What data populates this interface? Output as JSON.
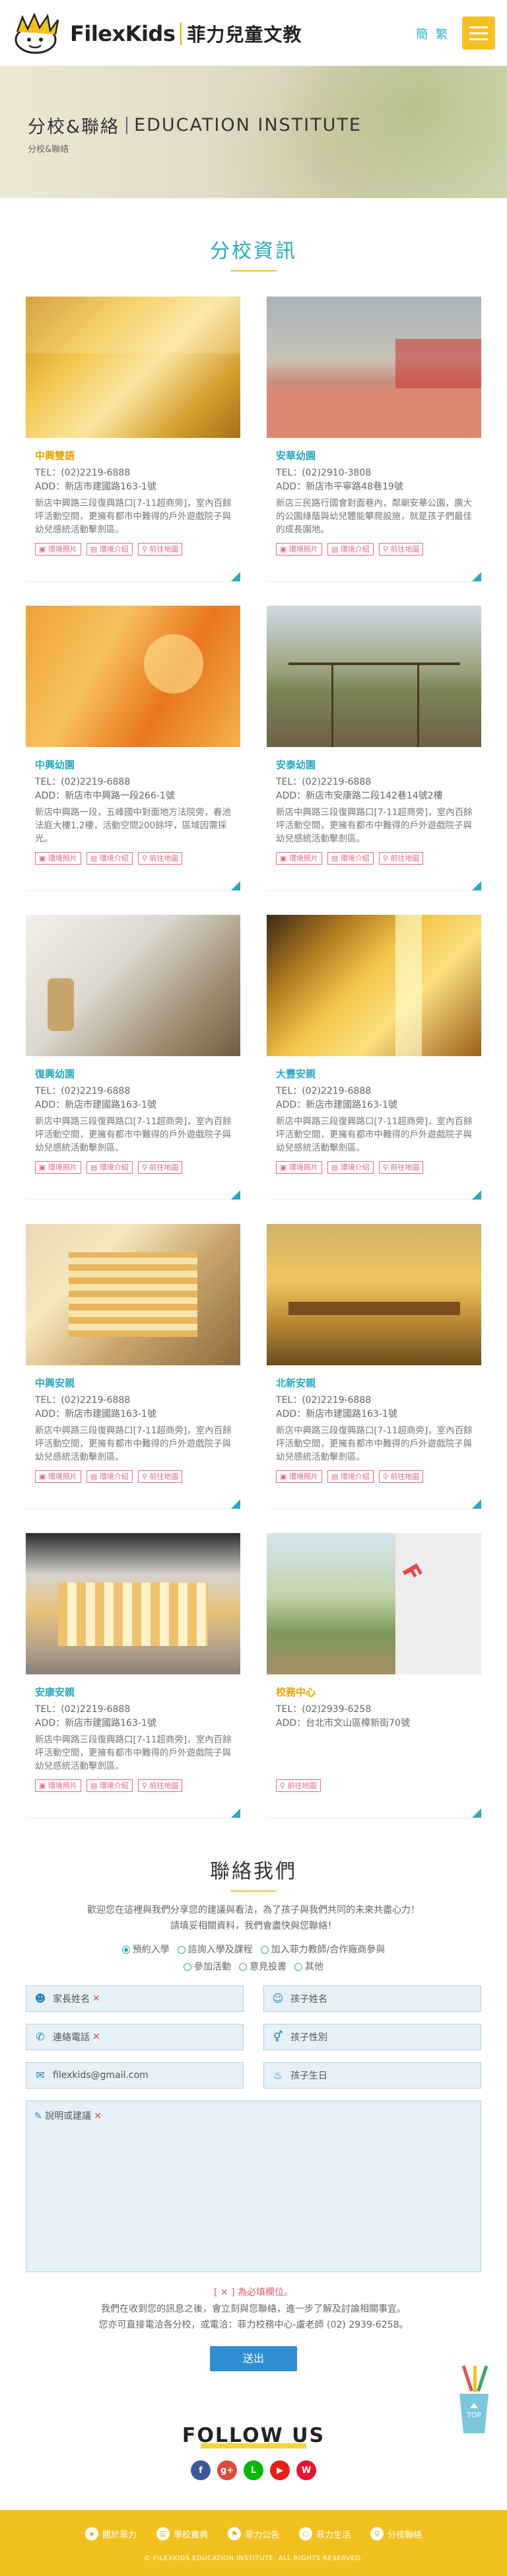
{
  "header": {
    "logo_text": "FilexKids",
    "logo_cn": "菲力兒童文教",
    "lang_simplified": "簡",
    "lang_traditional": "繁",
    "menu_icon": "hamburger-icon"
  },
  "banner": {
    "title_cn": "分校&聯絡",
    "title_en": "EDUCATION INSTITUTE",
    "breadcrumb": "分校&聯絡"
  },
  "schools_title": "分校資訊",
  "button_labels": {
    "photos": "環境照片",
    "intro": "環境介紹",
    "map": "前往地圖"
  },
  "schools": [
    {
      "name": "中興雙語",
      "tel": "TEL：(02)2219-6888",
      "add": "ADD：新店市建國路163-1號",
      "desc": "新店中興路三段復興路口[7-11超商旁]，室內百餘坪活動空間，更擁有都市中難得的戶外遊戲院子與幼兒感統活動擊劍區。",
      "color": "#e8a400"
    },
    {
      "name": "安華幼園",
      "tel": "TEL：(02)2910-3808",
      "add": "ADD：新店市平寧路48巷19號",
      "desc": "新店三民路行國會對面巷內，鄰廟安華公園，廣大的公園綠蔭與幼兒體能攀爬設施，就是孩子們最佳的成長園地。",
      "color": "#2aa9be"
    },
    {
      "name": "中興幼園",
      "tel": "TEL：(02)2219-6888",
      "add": "ADD：新店市中興路一段266-1號",
      "desc": "新店中興路一段，五峰國中對面地方法院旁，春池法庭大樓1,2樓，活動空間200餘坪，區域因需採光。",
      "color": "#2aa9be"
    },
    {
      "name": "安泰幼園",
      "tel": "TEL：(02)2219-6888",
      "add": "ADD：新店市安康路二段142巷14號2樓",
      "desc": "新店中興路三段復興路口[7-11超商旁]，室內百餘坪活動空間，更擁有都市中難得的戶外遊戲院子與幼兒感統活動擊劍區。",
      "color": "#2aa9be"
    },
    {
      "name": "復興幼園",
      "tel": "TEL：(02)2219-6888",
      "add": "ADD：新店市建國路163-1號",
      "desc": "新店中興路三段復興路口[7-11超商旁]，室內百餘坪活動空間，更擁有都市中難得的戶外遊戲院子與幼兒感統活動擊劍區。",
      "color": "#2aa9be"
    },
    {
      "name": "大豐安親",
      "tel": "TEL：(02)2219-6888",
      "add": "ADD：新店市建國路163-1號",
      "desc": "新店中興路三段復興路口[7-11超商旁]，室內百餘坪活動空間，更擁有都市中難得的戶外遊戲院子與幼兒感統活動擊劍區。",
      "color": "#2aa9be"
    },
    {
      "name": "中興安親",
      "tel": "TEL：(02)2219-6888",
      "add": "ADD：新店市建國路163-1號",
      "desc": "新店中興路三段復興路口[7-11超商旁]，室內百餘坪活動空間，更擁有都市中難得的戶外遊戲院子與幼兒感統活動擊劍區。",
      "color": "#2aa9be"
    },
    {
      "name": "北新安親",
      "tel": "TEL：(02)2219-6888",
      "add": "ADD：新店市建國路163-1號",
      "desc": "新店中興路三段復興路口[7-11超商旁]，室內百餘坪活動空間，更擁有都市中難得的戶外遊戲院子與幼兒感統活動擊劍區。",
      "color": "#2aa9be"
    },
    {
      "name": "安康安親",
      "tel": "TEL：(02)2219-6888",
      "add": "ADD：新店市建國路163-1號",
      "desc": "新店中興路三段復興路口[7-11超商旁]，室內百餘坪活動空間，更擁有都市中難得的戶外遊戲院子與幼兒感統活動擊劍區。",
      "color": "#2aa9be"
    },
    {
      "name": "校務中心",
      "tel": "TEL：(02)2939-6258",
      "add": "ADD：台北市文山區樟新街70號",
      "desc": "",
      "color": "#e8a400"
    }
  ],
  "contact": {
    "title": "聯絡我們",
    "intro_1": "歡迎您在這裡與我們分享您的建議與看法，為了孩子與我們共同的未來共盡心力！",
    "intro_2": "請填妥相關資料，我們會盡快與您聯絡！",
    "radios_row1": [
      "預約入學",
      "諮詢入學及課程",
      "加入菲力教師/合作廠商參與"
    ],
    "radios_row2": [
      "參加活動",
      "意見投書",
      "其他"
    ],
    "name_placeholder": "家長姓名",
    "child_name_placeholder": "孩子姓名",
    "phone_placeholder": "連絡電話",
    "child_gender_placeholder": "孩子性別",
    "email_value": "filexkids@gmail.com",
    "child_birthday_placeholder": "孩子生日",
    "message_placeholder": "說明或建議",
    "required_mark": "✕",
    "notice_title": "[ ✕ ] 為必填欄位。",
    "notice_1": "我們在收到您的訊息之後，會立刻與您聯絡，進一步了解及討論相關事宜。",
    "notice_2": "您亦可直接電洽各分校，或電洽：菲力校務中心-盧老師 (02) 2939-6258。",
    "submit": "送出"
  },
  "follow": {
    "title": "FOLLOW US",
    "socials": [
      {
        "icon": "facebook-icon",
        "glyph": "f",
        "color": "#3b5998"
      },
      {
        "icon": "google-plus-icon",
        "glyph": "g+",
        "color": "#dd4b39"
      },
      {
        "icon": "line-icon",
        "glyph": "L",
        "color": "#00b900"
      },
      {
        "icon": "youtube-icon",
        "glyph": "▶",
        "color": "#e62117"
      },
      {
        "icon": "weibo-icon",
        "glyph": "W",
        "color": "#e6162d"
      }
    ],
    "top_label": "TOP"
  },
  "footer": {
    "links": [
      "關於菲力",
      "學校寶典",
      "菲力公告",
      "菲力生活",
      "分校聯絡"
    ],
    "copyright": "© FILEXKIDS EDUCATION INSTITUTE. ALL RIGHTS RESERVED."
  }
}
